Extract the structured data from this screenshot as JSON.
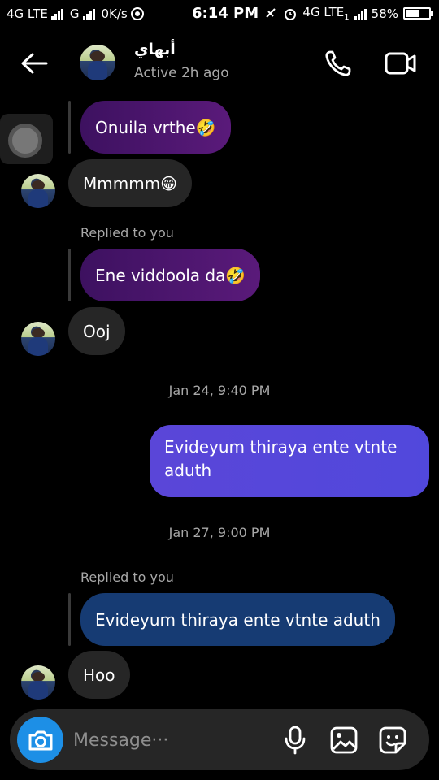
{
  "status_bar": {
    "network1": "4G LTE",
    "network2": "G",
    "speed": "0K/s",
    "time": "6:14 PM",
    "network3": "4G LTE",
    "network3_sub": "1",
    "battery": "58%",
    "battery_level": 0.58
  },
  "header": {
    "contact_name": "أبهاي",
    "status": "Active 2h ago",
    "icons": [
      "back-arrow-icon",
      "phone-icon",
      "video-camera-icon"
    ]
  },
  "messages": {
    "m1_text": "Onuila vrthe🤣",
    "m2_text": "Mmmmm😁",
    "m3_replied_label": "Replied to you",
    "m3_quoted": "Ene viddoola da🤣",
    "m4_text": "Ooj",
    "stamp1": "Jan 24, 9:40 PM",
    "m5_text": "Evideyum thiraya ente vtnte aduth",
    "stamp2": "Jan 27, 9:00 PM",
    "m6_replied_label": "Replied to you",
    "m6_quoted": "Evideyum thiraya ente vtnte aduth",
    "m7_text": "Hoo"
  },
  "composer": {
    "placeholder": "Message···",
    "icons": [
      "camera-icon",
      "microphone-icon",
      "gallery-icon",
      "sticker-icon"
    ]
  },
  "colors": {
    "background": "#000000",
    "incoming_bubble": "#262626",
    "outgoing_bubble": "#5148dc",
    "camera_button": "#1d8fe6"
  }
}
